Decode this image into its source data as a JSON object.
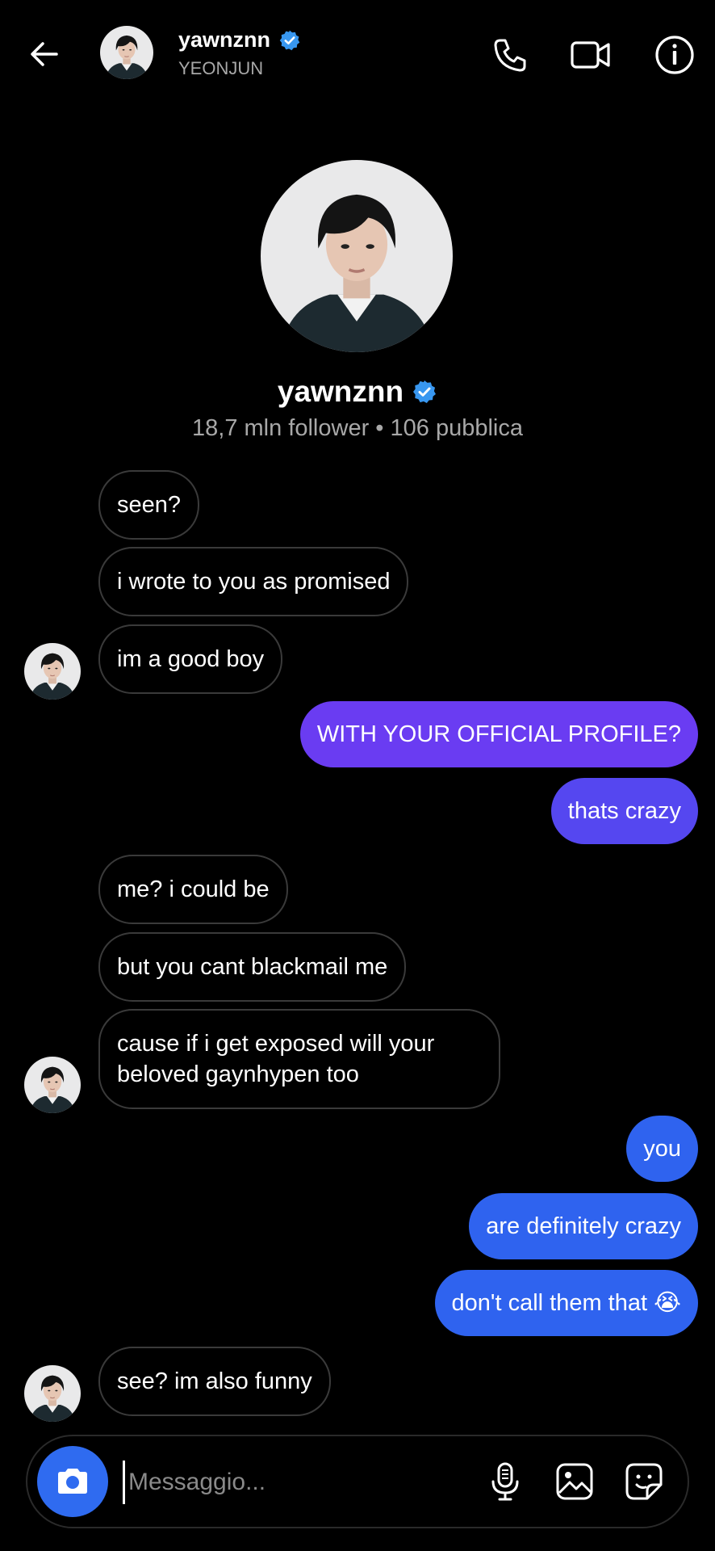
{
  "header": {
    "name": "yawnznn",
    "subtitle": "YEONJUN",
    "verified_icon": "verified-badge-icon",
    "actions": [
      "phone-icon",
      "video-icon",
      "info-icon"
    ]
  },
  "profile": {
    "name": "yawnznn",
    "stats": "18,7 mln follower • 106 pubblica"
  },
  "messages": [
    {
      "side": "in",
      "text": "seen?"
    },
    {
      "side": "in",
      "text": "i wrote to you as promised"
    },
    {
      "side": "in",
      "text": "im a good boy"
    },
    {
      "side": "out",
      "text": "WITH YOUR OFFICIAL PROFILE?"
    },
    {
      "side": "out",
      "text": "thats crazy"
    },
    {
      "side": "in",
      "text": "me? i could be"
    },
    {
      "side": "in",
      "text": "but you cant blackmail me"
    },
    {
      "side": "in",
      "text": "cause if i get exposed will your beloved gaynhypen too"
    },
    {
      "side": "out",
      "text": "you"
    },
    {
      "side": "out",
      "text": "are definitely crazy"
    },
    {
      "side": "out",
      "text": "don't call them that 😭"
    },
    {
      "side": "in",
      "text": "see? im also funny"
    }
  ],
  "composer": {
    "placeholder": "Messaggio...",
    "icons": [
      "camera-icon",
      "microphone-icon",
      "gallery-icon",
      "sticker-icon"
    ]
  },
  "colors": {
    "background": "#000000",
    "outgoing_purple": "#6a3cf2",
    "outgoing_violet": "#5547f0",
    "outgoing_blue": "#2f63ef",
    "verified": "#3897f0",
    "camera_button": "#2f6bf0"
  }
}
